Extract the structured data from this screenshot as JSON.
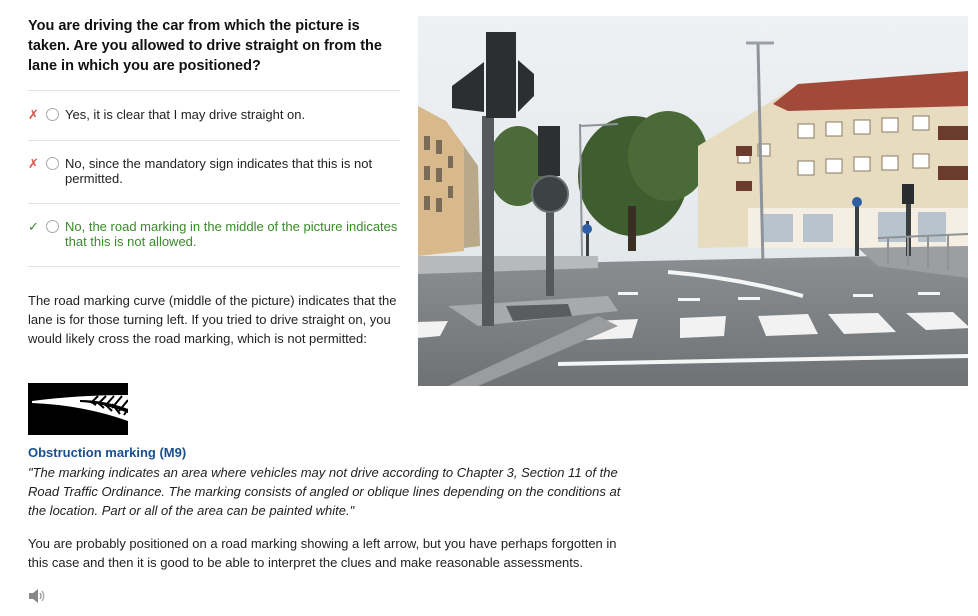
{
  "question": {
    "text": "You are driving the car from which the picture is taken. Are you allowed to drive straight on from the lane in which you are positioned?"
  },
  "answers": [
    {
      "mark": "✗",
      "status": "wrong",
      "text": "Yes, it is clear that I may drive straight on."
    },
    {
      "mark": "✗",
      "status": "wrong",
      "text": "No, since the mandatory sign indicates that this is not permitted."
    },
    {
      "mark": "✓",
      "status": "correct",
      "text": "No, the road marking in the middle of the picture indicates that this is not allowed."
    }
  ],
  "explanation": {
    "text": "The road marking curve (middle of the picture) indicates that the lane is for those turning left. If you tried to drive straight on, you would likely cross the road marking, which is not permitted:"
  },
  "sign": {
    "icon": "obstruction-marking-image",
    "title": "Obstruction marking (M9)",
    "quote": "\"The marking indicates an area where vehicles may not drive according to Chapter 3, Section 11 of the Road Traffic Ordinance. The marking consists of angled or oblique lines depending on the conditions at the location. Part or all of the area can be painted white.\""
  },
  "conclusion": {
    "text": "You are probably positioned on a road marking showing a left arrow, but you have perhaps forgotten in this case and then it is good to be able to interpret the clues and make reasonable assessments."
  },
  "audio": {
    "icon": "speaker-icon"
  },
  "photo": {
    "icon": "street-intersection-photo"
  },
  "colors": {
    "wrong": "#d9534f",
    "correct": "#3a8a2a",
    "link_title": "#1a4f8f"
  }
}
